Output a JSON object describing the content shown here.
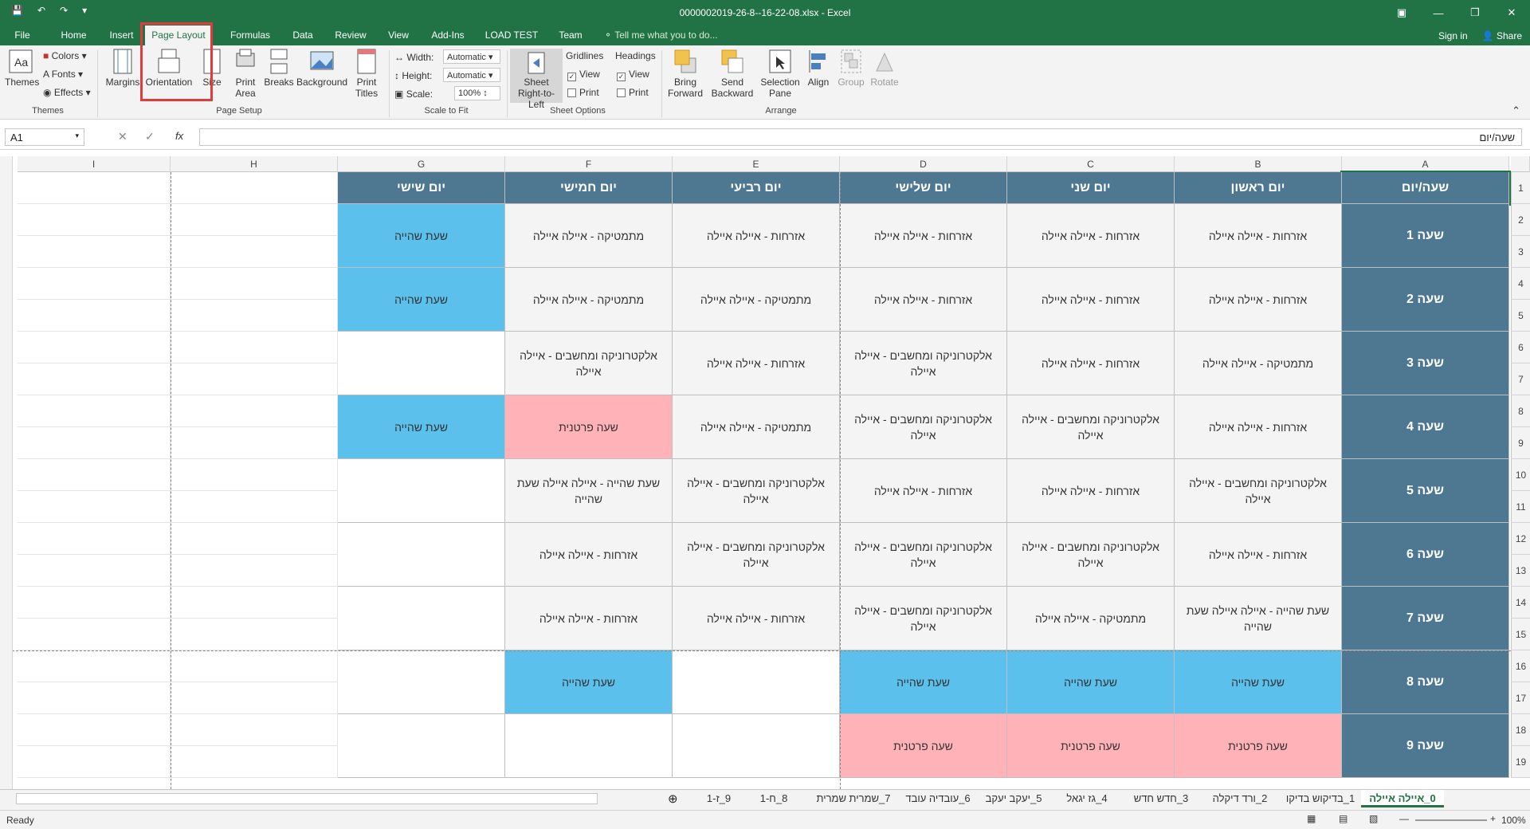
{
  "window": {
    "title": "0000002019-26-8--16-22-08.xlsx - Excel"
  },
  "tabs": [
    "File",
    "Home",
    "Insert",
    "Page Layout",
    "Formulas",
    "Data",
    "Review",
    "View",
    "Add-Ins",
    "LOAD TEST",
    "Team"
  ],
  "tell_me": "Tell me what you to do...",
  "signin": "Sign in",
  "share": "Share",
  "ribbon": {
    "themes": "Themes",
    "colors": "Colors",
    "fonts": "Fonts",
    "effects": "Effects",
    "margins": "Margins",
    "orientation": "Orientation",
    "size": "Size",
    "print_area": "Print Area",
    "breaks": "Breaks",
    "background": "Background",
    "print_titles": "Print Titles",
    "width_label": "Width:",
    "width_value": "Automatic",
    "height_label": "Height:",
    "height_value": "Automatic",
    "scale_label": "Scale:",
    "scale_value": "100%",
    "sheet_rtl": "Sheet Right-to-Left",
    "gridlines": "Gridlines",
    "headings": "Headings",
    "view": "View",
    "print": "Print",
    "bring_forward": "Bring Forward",
    "send_backward": "Send Backward",
    "selection_pane": "Selection Pane",
    "align": "Align",
    "group": "Group",
    "rotate": "Rotate",
    "groups": {
      "themes": "Themes",
      "page_setup": "Page Setup",
      "scale_to_fit": "Scale to Fit",
      "sheet_options": "Sheet Options",
      "arrange": "Arrange"
    }
  },
  "formula": {
    "namebox": "A1",
    "value": "שעה/יום",
    "fx": "fx"
  },
  "columns": [
    "I",
    "H",
    "G",
    "F",
    "E",
    "D",
    "C",
    "B",
    "A"
  ],
  "rows": [
    "1",
    "2",
    "3",
    "4",
    "5",
    "6",
    "7",
    "8",
    "9",
    "10",
    "11",
    "12",
    "13",
    "14",
    "15",
    "16",
    "17",
    "18",
    "19"
  ],
  "header_row": {
    "A": "שעה/יום",
    "B": "יום ראשון",
    "C": "יום שני",
    "D": "יום שלישי",
    "E": "יום רביעי",
    "F": "יום חמישי",
    "G": "יום שישי"
  },
  "periods": [
    {
      "label": "שעה 1",
      "B": "אזרחות - איילה איילה",
      "C": "אזרחות - איילה איילה",
      "D": "אזרחות - איילה איילה",
      "E": "אזרחות - איילה איילה",
      "F": "מתמטיקה - איילה איילה",
      "G": "שעת שהייה"
    },
    {
      "label": "שעה 2",
      "B": "אזרחות - איילה איילה",
      "C": "אזרחות - איילה איילה",
      "D": "אזרחות - איילה איילה",
      "E": "מתמטיקה - איילה איילה",
      "F": "מתמטיקה - איילה איילה",
      "G": "שעת שהייה"
    },
    {
      "label": "שעה 3",
      "B": "מתמטיקה - איילה איילה",
      "C": "אזרחות - איילה איילה",
      "D": "אלקטרוניקה ומחשבים - איילה איילה",
      "E": "אזרחות - איילה איילה",
      "F": "אלקטרוניקה ומחשבים - איילה איילה",
      "G": ""
    },
    {
      "label": "שעה 4",
      "B": "אזרחות - איילה איילה",
      "C": "אלקטרוניקה ומחשבים - איילה איילה",
      "D": "אלקטרוניקה ומחשבים - איילה איילה",
      "E": "מתמטיקה - איילה איילה",
      "F": "שעה פרטנית",
      "G": "שעת שהייה"
    },
    {
      "label": "שעה 5",
      "B": "אלקטרוניקה ומחשבים - איילה איילה",
      "C": "אזרחות - איילה איילה",
      "D": "אזרחות - איילה איילה",
      "E": "אלקטרוניקה ומחשבים - איילה איילה",
      "F": "שעת שהייה - איילה איילה שעת שהייה",
      "G": ""
    },
    {
      "label": "שעה 6",
      "B": "אזרחות - איילה איילה",
      "C": "אלקטרוניקה ומחשבים - איילה איילה",
      "D": "אלקטרוניקה ומחשבים - איילה איילה",
      "E": "אלקטרוניקה ומחשבים - איילה איילה",
      "F": "אזרחות - איילה איילה",
      "G": ""
    },
    {
      "label": "שעה 7",
      "B": "שעת שהייה - איילה איילה שעת שהייה",
      "C": "מתמטיקה - איילה איילה",
      "D": "אלקטרוניקה ומחשבים - איילה איילה",
      "E": "אזרחות - איילה איילה",
      "F": "אזרחות - איילה איילה",
      "G": ""
    },
    {
      "label": "שעה 8",
      "B": "שעת שהייה",
      "C": "שעת שהייה",
      "D": "שעת שהייה",
      "E": "",
      "F": "שעת שהייה",
      "G": ""
    },
    {
      "label": "שעה 9",
      "B": "שעה פרטנית",
      "C": "שעה פרטנית",
      "D": "שעה פרטנית",
      "E": "",
      "F": "",
      "G": ""
    }
  ],
  "sheet_tabs": [
    "0_איילה איילה",
    "1_בדיקוש בדיקו",
    "2_ורד דיקלה",
    "3_חדש חדש",
    "4_גז יגאל",
    "5_יעקב יעקב",
    "6_עובדיה עובד",
    "7_שמרית שמרית",
    "8_ח-1",
    "9_ז-1"
  ],
  "status": {
    "ready": "Ready",
    "zoom": "100%"
  }
}
